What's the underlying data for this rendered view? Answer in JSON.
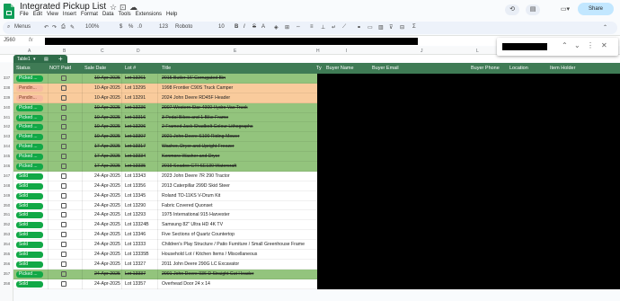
{
  "doc_title": "Integrated Pickup List",
  "menu": [
    "File",
    "Edit",
    "View",
    "Insert",
    "Format",
    "Data",
    "Tools",
    "Extensions",
    "Help"
  ],
  "share_label": "Share",
  "toolbar": {
    "search": "Menus",
    "zoom": "100%",
    "currency": "$",
    "percent": "%",
    "decimals": ".0",
    ".00": ".00",
    "format123": "123",
    "font": "Roboto",
    "font_size": "10"
  },
  "cell_ref": "J560",
  "fx": "fx",
  "table_tab": "Table1",
  "col_letters": [
    "A",
    "B",
    "C",
    "D",
    "E",
    "H",
    "I",
    "J",
    "L",
    "M",
    "N"
  ],
  "headers": [
    "Status",
    "NOT Paid",
    "Sale Date",
    "Lot #",
    "Title",
    "Ty",
    "Buyer Name",
    "Buyer Email",
    "Buyer Phone",
    "Location",
    "Item Holder"
  ],
  "colors": {
    "green": "#93c47d",
    "orange": "#f9cb9c",
    "white": "#ffffff",
    "chip_green": "#11a846",
    "chip_orange": "#f7bba1",
    "header": "#3f7b55"
  },
  "rows": [
    {
      "n": "337",
      "status": "Picked ...",
      "date": "10-Apr-2025",
      "lot": "Lot 13261",
      "title": "2015 Butler 16' Corrugated Bin",
      "bg": "green",
      "chip": "green",
      "strike": true
    },
    {
      "n": "338",
      "status": "Pendin...",
      "date": "10-Apr-2025",
      "lot": "Lot 13295",
      "title": "1998 Frontier C90S Truck Camper",
      "bg": "orange",
      "chip": "orange",
      "strike": false
    },
    {
      "n": "339",
      "status": "Pendin...",
      "date": "10-Apr-2025",
      "lot": "Lot 13291",
      "title": "2024 John Deere RD45F Header",
      "bg": "orange",
      "chip": "orange",
      "strike": false
    },
    {
      "n": "340",
      "status": "Picked ...",
      "date": "10-Apr-2025",
      "lot": "Lot 13236",
      "title": "2007 Western Star 4900 Hydro Vac Truck",
      "bg": "green",
      "chip": "green",
      "strike": true
    },
    {
      "n": "341",
      "status": "Picked ...",
      "date": "10-Apr-2025",
      "lot": "Lot 13316",
      "title": "3 Pedal Bikes and 1 Bike Frame",
      "bg": "green",
      "chip": "green",
      "strike": true
    },
    {
      "n": "342",
      "status": "Picked ...",
      "date": "10-Apr-2025",
      "lot": "Lot 13296",
      "title": "2 Framed Jack Shadbolt Colour Lithographs",
      "bg": "green",
      "chip": "green",
      "strike": true
    },
    {
      "n": "343",
      "status": "Picked ...",
      "date": "10-Apr-2025",
      "lot": "Lot 13307",
      "title": "2021 John Deere S100 Riding Mower",
      "bg": "green",
      "chip": "green",
      "strike": true
    },
    {
      "n": "344",
      "status": "Picked ...",
      "date": "17-Apr-2025",
      "lot": "Lot 13317",
      "title": "Washer, Dryer and Upright Freezer",
      "bg": "green",
      "chip": "green",
      "strike": true
    },
    {
      "n": "345",
      "status": "Picked ...",
      "date": "17-Apr-2025",
      "lot": "Lot 13334",
      "title": "Kenmore Washer and Dryer",
      "bg": "green",
      "chip": "green",
      "strike": true
    },
    {
      "n": "346",
      "status": "Picked ...",
      "date": "17-Apr-2025",
      "lot": "Lot 13335",
      "title": "2019 Seadoo GTI SE130 Watercraft",
      "bg": "green",
      "chip": "green",
      "strike": true
    },
    {
      "n": "347",
      "status": "Sold",
      "date": "24-Apr-2025",
      "lot": "Lot 13343",
      "title": "2023 John Deere 7R 290 Tractor",
      "bg": "white",
      "chip": "green",
      "strike": false
    },
    {
      "n": "348",
      "status": "Sold",
      "date": "24-Apr-2025",
      "lot": "Lot 13356",
      "title": "2013 Caterpillar 299D Skid Steer",
      "bg": "white",
      "chip": "green",
      "strike": false
    },
    {
      "n": "349",
      "status": "Sold",
      "date": "24-Apr-2025",
      "lot": "Lot 13345",
      "title": "Roland TD-11KS V-Drum Kit",
      "bg": "white",
      "chip": "green",
      "strike": false
    },
    {
      "n": "350",
      "status": "Sold",
      "date": "24-Apr-2025",
      "lot": "Lot 13290",
      "title": "Fabric Covered Quonset",
      "bg": "white",
      "chip": "green",
      "strike": false
    },
    {
      "n": "351",
      "status": "Sold",
      "date": "24-Apr-2025",
      "lot": "Lot 13293",
      "title": "1975 International 915 Harvester",
      "bg": "white",
      "chip": "green",
      "strike": false
    },
    {
      "n": "352",
      "status": "Sold",
      "date": "24-Apr-2025",
      "lot": "Lot 13324B",
      "title": "Samsung 82\" Ultra HD 4K TV",
      "bg": "white",
      "chip": "green",
      "strike": false
    },
    {
      "n": "353",
      "status": "Sold",
      "date": "24-Apr-2025",
      "lot": "Lot 13346",
      "title": "Five Sections of Quartz Countertop",
      "bg": "white",
      "chip": "green",
      "strike": false
    },
    {
      "n": "354",
      "status": "Sold",
      "date": "24-Apr-2025",
      "lot": "Lot 13333",
      "title": "Children's Play Structure / Patio Furniture / Small Greenhouse Frame",
      "bg": "white",
      "chip": "green",
      "strike": false
    },
    {
      "n": "355",
      "status": "Sold",
      "date": "24-Apr-2025",
      "lot": "Lot 13335B",
      "title": "Household Lot / Kitchen Items / Miscellaneous",
      "bg": "white",
      "chip": "green",
      "strike": false
    },
    {
      "n": "356",
      "status": "Sold",
      "date": "24-Apr-2025",
      "lot": "Lot 13327",
      "title": "2011 John Deere 290G LC Excavator",
      "bg": "white",
      "chip": "green",
      "strike": false
    },
    {
      "n": "357",
      "status": "Picked ...",
      "date": "24-Apr-2025",
      "lot": "Lot 13337",
      "title": "2001 John Deere 936 D Straight Cut Header",
      "bg": "green",
      "chip": "green",
      "strike": true
    },
    {
      "n": "358",
      "status": "Sold",
      "date": "24-Apr-2025",
      "lot": "Lot 13357",
      "title": "Overhead Door 24 x 14",
      "bg": "white",
      "chip": "green",
      "strike": false
    }
  ]
}
